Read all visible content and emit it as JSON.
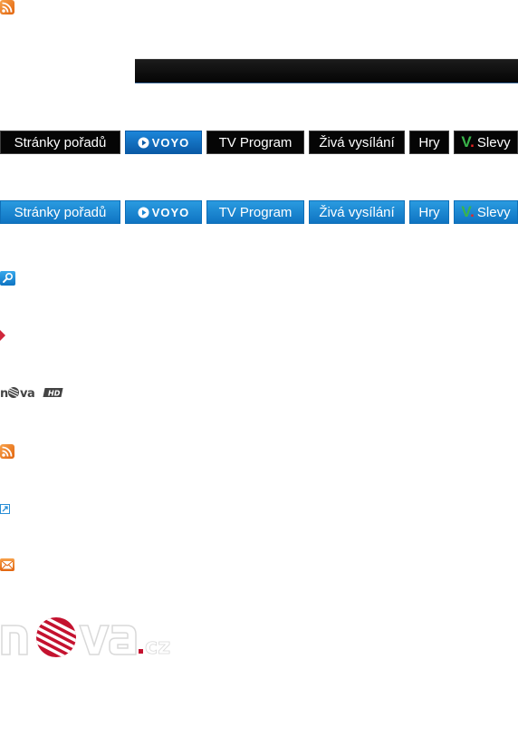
{
  "icons": {
    "rss": "rss-icon",
    "search": "search-icon",
    "arrow": "arrow-right-icon",
    "external": "external-link-icon",
    "mail": "mail-icon"
  },
  "colors": {
    "nav_dark_bg": "#050505",
    "nav_light_bg": "#1a86d2",
    "accent_red": "#d0263b",
    "voyo_green": "#3ab54a"
  },
  "nav_dark": {
    "items": [
      "Stránky pořadů",
      "VOYO",
      "TV Program",
      "Živá vysílání",
      "Hry",
      "Slevy"
    ]
  },
  "nav_light": {
    "items": [
      "Stránky pořadů",
      "VOYO",
      "TV Program",
      "Živá vysílání",
      "Hry",
      "Slevy"
    ]
  },
  "logos": {
    "nova_hd": "nova HD",
    "nova_cz": "nova.cz"
  }
}
